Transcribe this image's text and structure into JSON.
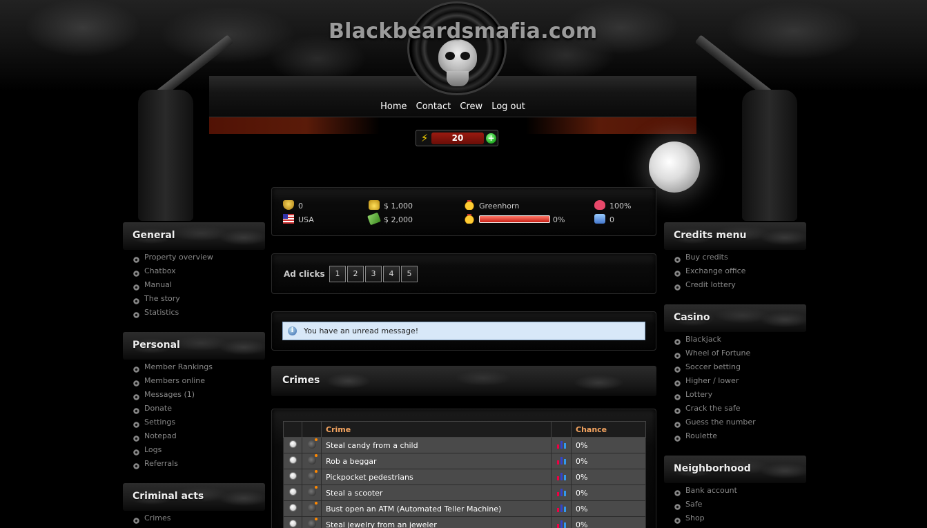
{
  "site": {
    "title": "Blackbeardsmafia.com"
  },
  "nav": {
    "items": [
      "Home",
      "Contact",
      "Crew",
      "Log out"
    ]
  },
  "energy": {
    "value": "20"
  },
  "stats": {
    "bullets": "0",
    "country": "USA",
    "cash": "$ 1,000",
    "bank": "$ 2,000",
    "rank": "Greenhorn",
    "rank_progress": "0%",
    "rank_progress_fraction": 1.0,
    "health": "100%",
    "calls": "0"
  },
  "ads": {
    "label": "Ad clicks",
    "buttons": [
      "1",
      "2",
      "3",
      "4",
      "5"
    ]
  },
  "message": {
    "text": "You have an unread message!"
  },
  "crimes": {
    "title": "Crimes",
    "columns": {
      "crime": "Crime",
      "chance": "Chance"
    },
    "rows": [
      {
        "name": "Steal candy from a child",
        "chance": "0%"
      },
      {
        "name": "Rob a beggar",
        "chance": "0%"
      },
      {
        "name": "Pickpocket pedestrians",
        "chance": "0%"
      },
      {
        "name": "Steal a scooter",
        "chance": "0%"
      },
      {
        "name": "Bust open an ATM (Automated Teller Machine)",
        "chance": "0%"
      },
      {
        "name": "Steal jewelry from an jeweler",
        "chance": "0%"
      }
    ]
  },
  "left_sidebar": {
    "general": {
      "title": "General",
      "items": [
        "Property overview",
        "Chatbox",
        "Manual",
        "The story",
        "Statistics"
      ]
    },
    "personal": {
      "title": "Personal",
      "items": [
        "Member Rankings",
        "Members online",
        "Messages (1)",
        "Donate",
        "Settings",
        "Notepad",
        "Logs",
        "Referrals"
      ]
    },
    "criminal": {
      "title": "Criminal acts",
      "items": [
        "Crimes"
      ]
    }
  },
  "right_sidebar": {
    "credits": {
      "title": "Credits menu",
      "items": [
        "Buy credits",
        "Exchange office",
        "Credit lottery"
      ]
    },
    "casino": {
      "title": "Casino",
      "items": [
        "Blackjack",
        "Wheel of Fortune",
        "Soccer betting",
        "Higher / lower",
        "Lottery",
        "Crack the safe",
        "Guess the number",
        "Roulette"
      ]
    },
    "neighborhood": {
      "title": "Neighborhood",
      "items": [
        "Bank account",
        "Safe",
        "Shop"
      ]
    }
  }
}
